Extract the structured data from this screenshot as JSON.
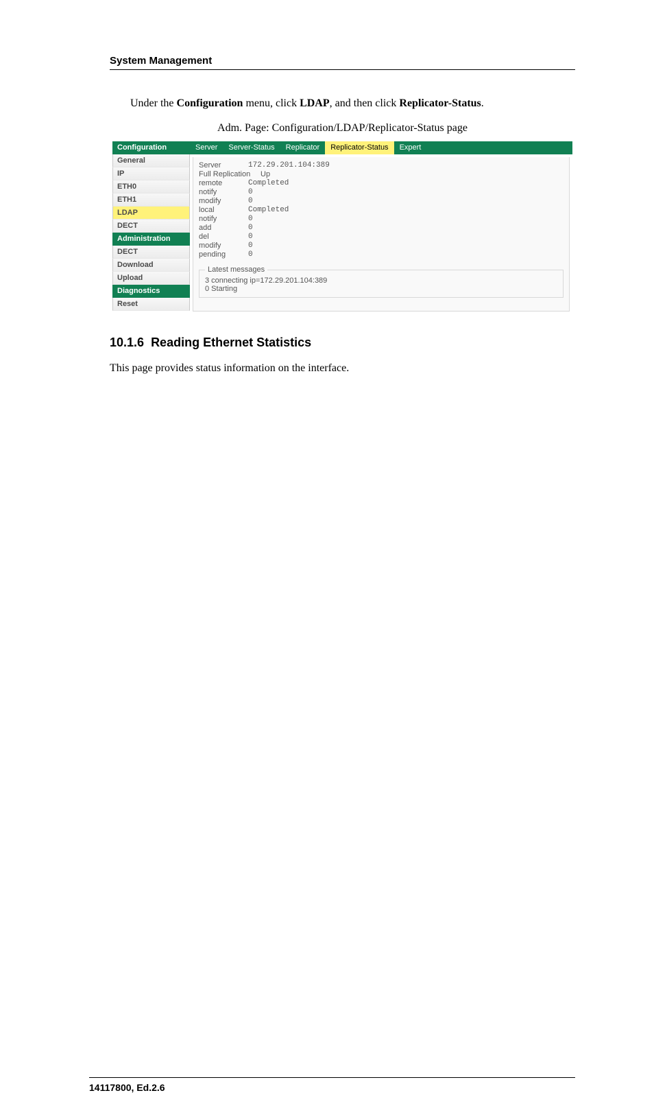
{
  "header": {
    "section_title": "System Management"
  },
  "intro": {
    "pre": "Under the ",
    "menu": "Configuration",
    "mid1": " menu, click ",
    "item1": "LDAP",
    "mid2": ", and then click ",
    "item2": "Replicator-Status",
    "end": "."
  },
  "caption": "Adm. Page: Configuration/LDAP/Replicator-Status page",
  "sidebar": {
    "groups": [
      {
        "title": "Configuration",
        "items": [
          "General",
          "IP",
          "ETH0",
          "ETH1",
          "LDAP",
          "DECT"
        ],
        "active_index": 4
      },
      {
        "title": "Administration",
        "items": [
          "DECT",
          "Download",
          "Upload"
        ],
        "active_index": -1
      },
      {
        "title": "Diagnostics",
        "items": [
          "Reset"
        ],
        "active_index": -1
      }
    ]
  },
  "tabs": {
    "items": [
      "Server",
      "Server-Status",
      "Replicator",
      "Replicator-Status",
      "Expert"
    ],
    "active_index": 3
  },
  "status": {
    "rows": [
      {
        "k": "Server",
        "v": "172.29.201.104:389",
        "mono": true
      },
      {
        "k": "Full Replication",
        "v": "Up",
        "mono": false
      },
      {
        "k": "remote",
        "v": "Completed",
        "mono": true
      },
      {
        "k": "notify",
        "v": "0",
        "mono": true
      },
      {
        "k": "modify",
        "v": "0",
        "mono": true
      },
      {
        "k": "local",
        "v": "Completed",
        "mono": true
      },
      {
        "k": "notify",
        "v": "0",
        "mono": true
      },
      {
        "k": "add",
        "v": "0",
        "mono": true
      },
      {
        "k": "del",
        "v": "0",
        "mono": true
      },
      {
        "k": "modify",
        "v": "0",
        "mono": true
      },
      {
        "k": "pending",
        "v": "0",
        "mono": true
      }
    ],
    "messages_legend": "Latest messages",
    "messages": [
      "3 connecting ip=172.29.201.104:389",
      "0 Starting"
    ]
  },
  "subsection": {
    "number": "10.1.6",
    "title": "Reading Ethernet Statistics",
    "body": "This page provides status information on the interface."
  },
  "footer": {
    "doc_id": "14117800, Ed.2.6"
  }
}
